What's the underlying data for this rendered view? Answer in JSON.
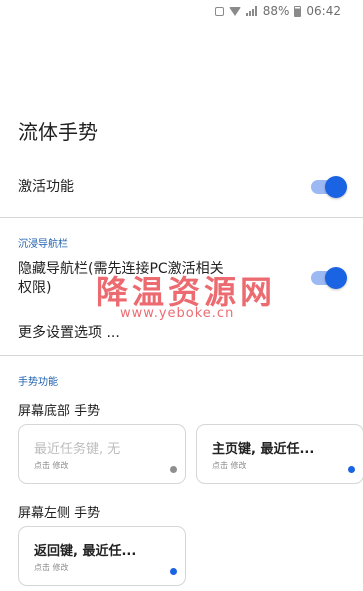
{
  "status_bar": {
    "battery": "88%",
    "time": "06:42",
    "icons": [
      "vibrate-icon",
      "wifi-icon",
      "signal-icon",
      "battery-icon"
    ]
  },
  "page": {
    "title": "流体手势"
  },
  "activate": {
    "label": "激活功能",
    "enabled": true
  },
  "immersive_nav": {
    "header": "沉浸导航栏",
    "hide_nav_label": "隐藏导航栏(需先连接PC激活相关权限)",
    "hide_nav_enabled": true,
    "more_settings_label": "更多设置选项 ..."
  },
  "gesture_functions": {
    "header": "手势功能",
    "bottom": {
      "label": "屏幕底部 手势",
      "cards": [
        {
          "title": "最近任务键, 无",
          "sub": "点击 修改",
          "disabled": true
        },
        {
          "title": "主页键, 最近任...",
          "sub": "点击 修改",
          "disabled": false
        }
      ]
    },
    "left": {
      "label": "屏幕左侧 手势",
      "cards": [
        {
          "title": "返回键, 最近任...",
          "sub": "点击 修改",
          "disabled": false
        }
      ]
    }
  },
  "watermark": {
    "text": "降温资源网",
    "url": "www.yeboke.cn"
  },
  "colors": {
    "accent": "#1a63e3",
    "toggle_track": "#9cb9f3",
    "section_header": "#1e5fae",
    "divider": "#d6d6d6",
    "watermark": "#e4333a"
  }
}
